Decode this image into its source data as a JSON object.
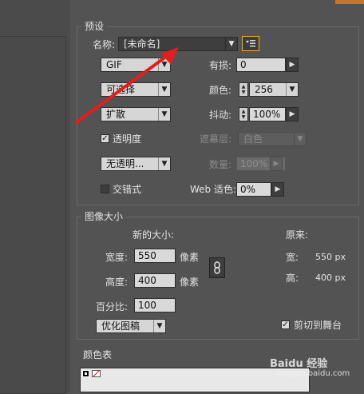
{
  "preset": {
    "group_title": "预设",
    "name_label": "名称:",
    "name_value": "[未命名]",
    "format": "GIF",
    "lossy_label": "有损:",
    "lossy_value": "0",
    "palette": "可选择",
    "colors_label": "颜色:",
    "colors_value": "256",
    "dither_method": "扩散",
    "dither_label": "抖动:",
    "dither_value": "100%",
    "transparency_label": "透明度",
    "matte_label": "遮幕层:",
    "matte_value": "白色",
    "transparency_dither": "无透明...",
    "amount_label": "数量:",
    "amount_value": "100%",
    "interlaced_label": "交错式",
    "web_snap_label": "Web 适色:",
    "web_snap_value": "0%"
  },
  "image_size": {
    "group_title": "图像大小",
    "new_size_label": "新的大小:",
    "original_label": "原来:",
    "width_label": "宽度:",
    "width_value": "550",
    "width_unit": "像素",
    "height_label": "高度:",
    "height_value": "400",
    "height_unit": "像素",
    "percent_label": "百分比:",
    "percent_value": "100",
    "quality": "优化图稿",
    "orig_width_label": "宽:",
    "orig_width_value": "550 px",
    "orig_height_label": "高:",
    "orig_height_value": "400 px",
    "clip_label": "剪切到舞台"
  },
  "color_table": {
    "group_title": "颜色表"
  },
  "watermark": {
    "text": "Baidu 经验",
    "url": "jingyan.baidu.com"
  },
  "colors": {
    "annotation_arrow": "#e21e1e",
    "highlight_button": "#f0b41e"
  }
}
